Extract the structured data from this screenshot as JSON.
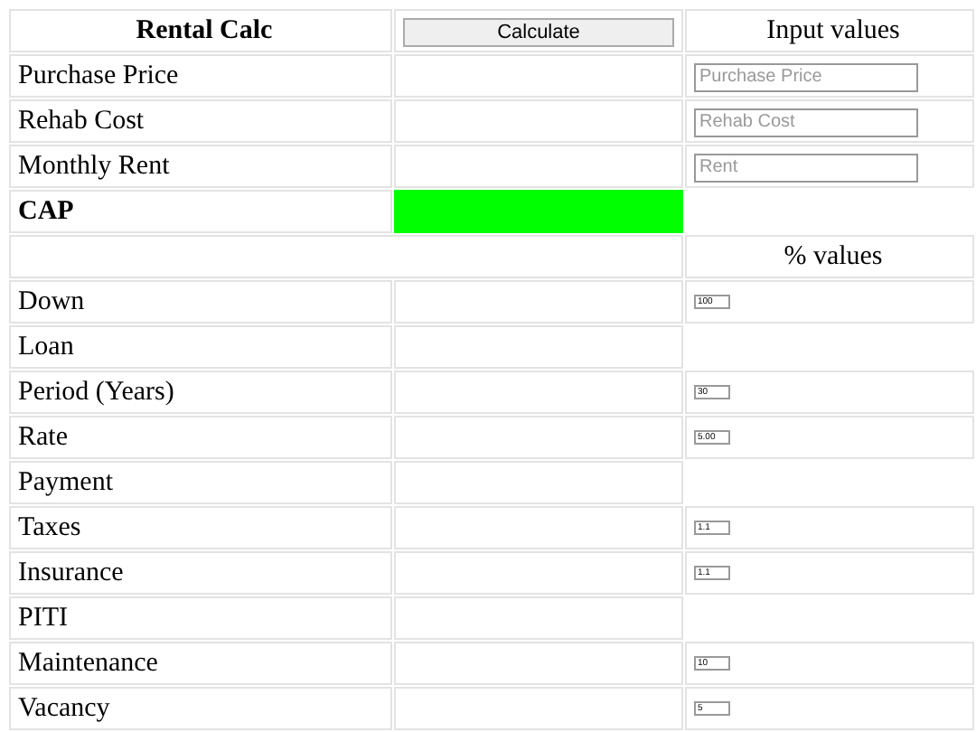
{
  "header": {
    "title": "Rental Calc",
    "button": "Calculate",
    "column_header": "Input values"
  },
  "input_rows": [
    {
      "label": "Purchase Price",
      "placeholder": "Purchase Price"
    },
    {
      "label": "Rehab Cost",
      "placeholder": "Rehab Cost"
    },
    {
      "label": "Monthly Rent",
      "placeholder": "Rent"
    }
  ],
  "cap_row": {
    "label": "CAP",
    "color": "#00ff00"
  },
  "percent_header": "% values",
  "percent_rows": [
    {
      "label": "Down",
      "value": "100"
    },
    {
      "label": "Loan"
    },
    {
      "label": "Period (Years)",
      "value": "30"
    },
    {
      "label": "Rate",
      "value": "5.00"
    },
    {
      "label": "Payment"
    },
    {
      "label": "Taxes",
      "value": "1.1"
    },
    {
      "label": "Insurance",
      "value": "1.1"
    },
    {
      "label": "PITI"
    },
    {
      "label": "Maintenance",
      "value": "10"
    },
    {
      "label": "Vacancy",
      "value": "5"
    }
  ]
}
